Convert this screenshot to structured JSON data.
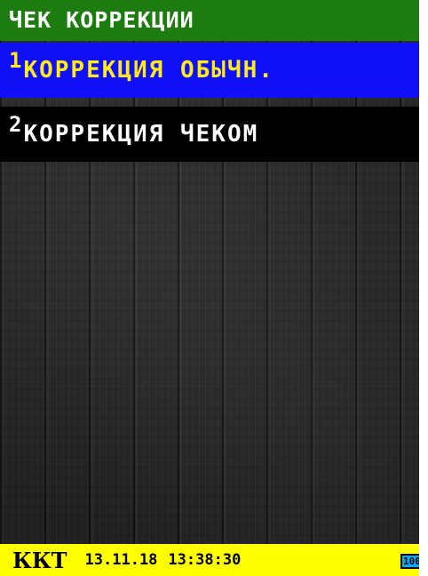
{
  "title": "ЧЕК КОРРЕКЦИИ",
  "menu": {
    "items": [
      {
        "number": "1",
        "label": "КОРРЕКЦИЯ ОБЫЧН.",
        "selected": true
      },
      {
        "number": "2",
        "label": "КОРРЕКЦИЯ ЧЕКОМ",
        "selected": false
      }
    ]
  },
  "status": {
    "mode": "ККТ",
    "date": "13.11.18",
    "time": "13:38:30",
    "battery": "100"
  },
  "colors": {
    "title_bg": "#1c7c10",
    "selected_bg": "#1010f6",
    "selected_text": "#ffea1a",
    "normal_bg": "#000000",
    "status_bg": "#ffff00",
    "battery_bg": "#00aaff"
  }
}
